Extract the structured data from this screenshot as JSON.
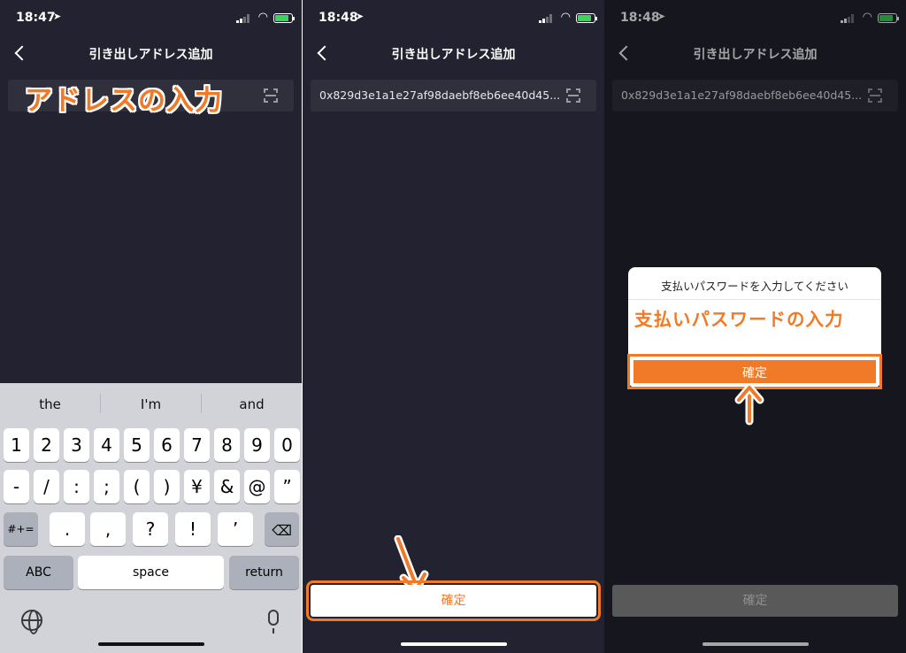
{
  "panels": [
    {
      "status": {
        "time": "18:47",
        "location_glyph": "➤"
      },
      "nav": {
        "title": "引き出しアドレス追加"
      },
      "address_placeholder": "",
      "annotation": "アドレスの入力",
      "keyboard": {
        "suggestions": [
          "the",
          "I'm",
          "and"
        ],
        "row1": [
          "1",
          "2",
          "3",
          "4",
          "5",
          "6",
          "7",
          "8",
          "9",
          "0"
        ],
        "row2": [
          "-",
          "/",
          ":",
          ";",
          "(",
          ")",
          "¥",
          "&",
          "@",
          "”"
        ],
        "row3_left": "#+=",
        "row3": [
          ".",
          ",",
          "?",
          "!",
          "’"
        ],
        "abc": "ABC",
        "space": "space",
        "return": "return"
      }
    },
    {
      "status": {
        "time": "18:48",
        "location_glyph": "➤"
      },
      "nav": {
        "title": "引き出しアドレス追加"
      },
      "address_value": "0x829d3e1a1e27af98daebf8eb6ee40d45...",
      "confirm_label": "確定"
    },
    {
      "status": {
        "time": "18:48",
        "location_glyph": "➤"
      },
      "nav": {
        "title": "引き出しアドレス追加"
      },
      "address_value": "0x829d3e1a1e27af98daebf8eb6ee40d45...",
      "dialog": {
        "message": "支払いパスワードを入力してください",
        "annotation": "支払いパスワードの入力",
        "button": "確定"
      },
      "confirm_label": "確定"
    }
  ],
  "colors": {
    "accent": "#f07a27",
    "bg": "#222230",
    "field": "#30303d"
  }
}
